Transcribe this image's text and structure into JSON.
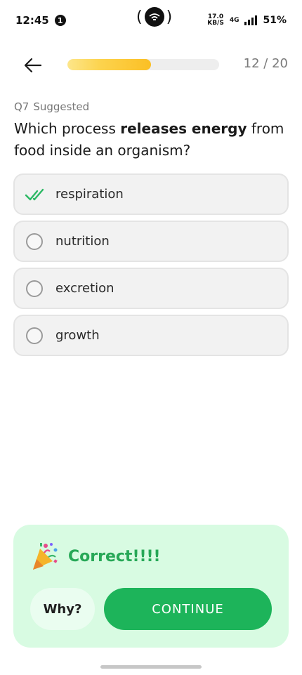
{
  "status_bar": {
    "time": "12:45",
    "notification_count": "1",
    "speed_value": "17.0",
    "speed_unit": "KB/S",
    "network": "4G",
    "battery": "51%"
  },
  "header": {
    "progress_fraction": 0.55,
    "progress_text": "12 / 20"
  },
  "question": {
    "number": "Q7",
    "tag": "Suggested",
    "text_before": "Which process ",
    "text_bold": "releases energy",
    "text_after": " from food inside an organism?"
  },
  "options": [
    {
      "label": "respiration",
      "state": "correct-selected"
    },
    {
      "label": "nutrition",
      "state": "unselected"
    },
    {
      "label": "excretion",
      "state": "unselected"
    },
    {
      "label": "growth",
      "state": "unselected"
    }
  ],
  "feedback": {
    "title": "Correct!!!!",
    "why_label": "Why?",
    "continue_label": "CONTINUE"
  },
  "colors": {
    "accent_green": "#1db45a",
    "panel_green": "#d8fbe2",
    "progress_yellow": "#fbbf24",
    "check_green": "#2bb864"
  }
}
